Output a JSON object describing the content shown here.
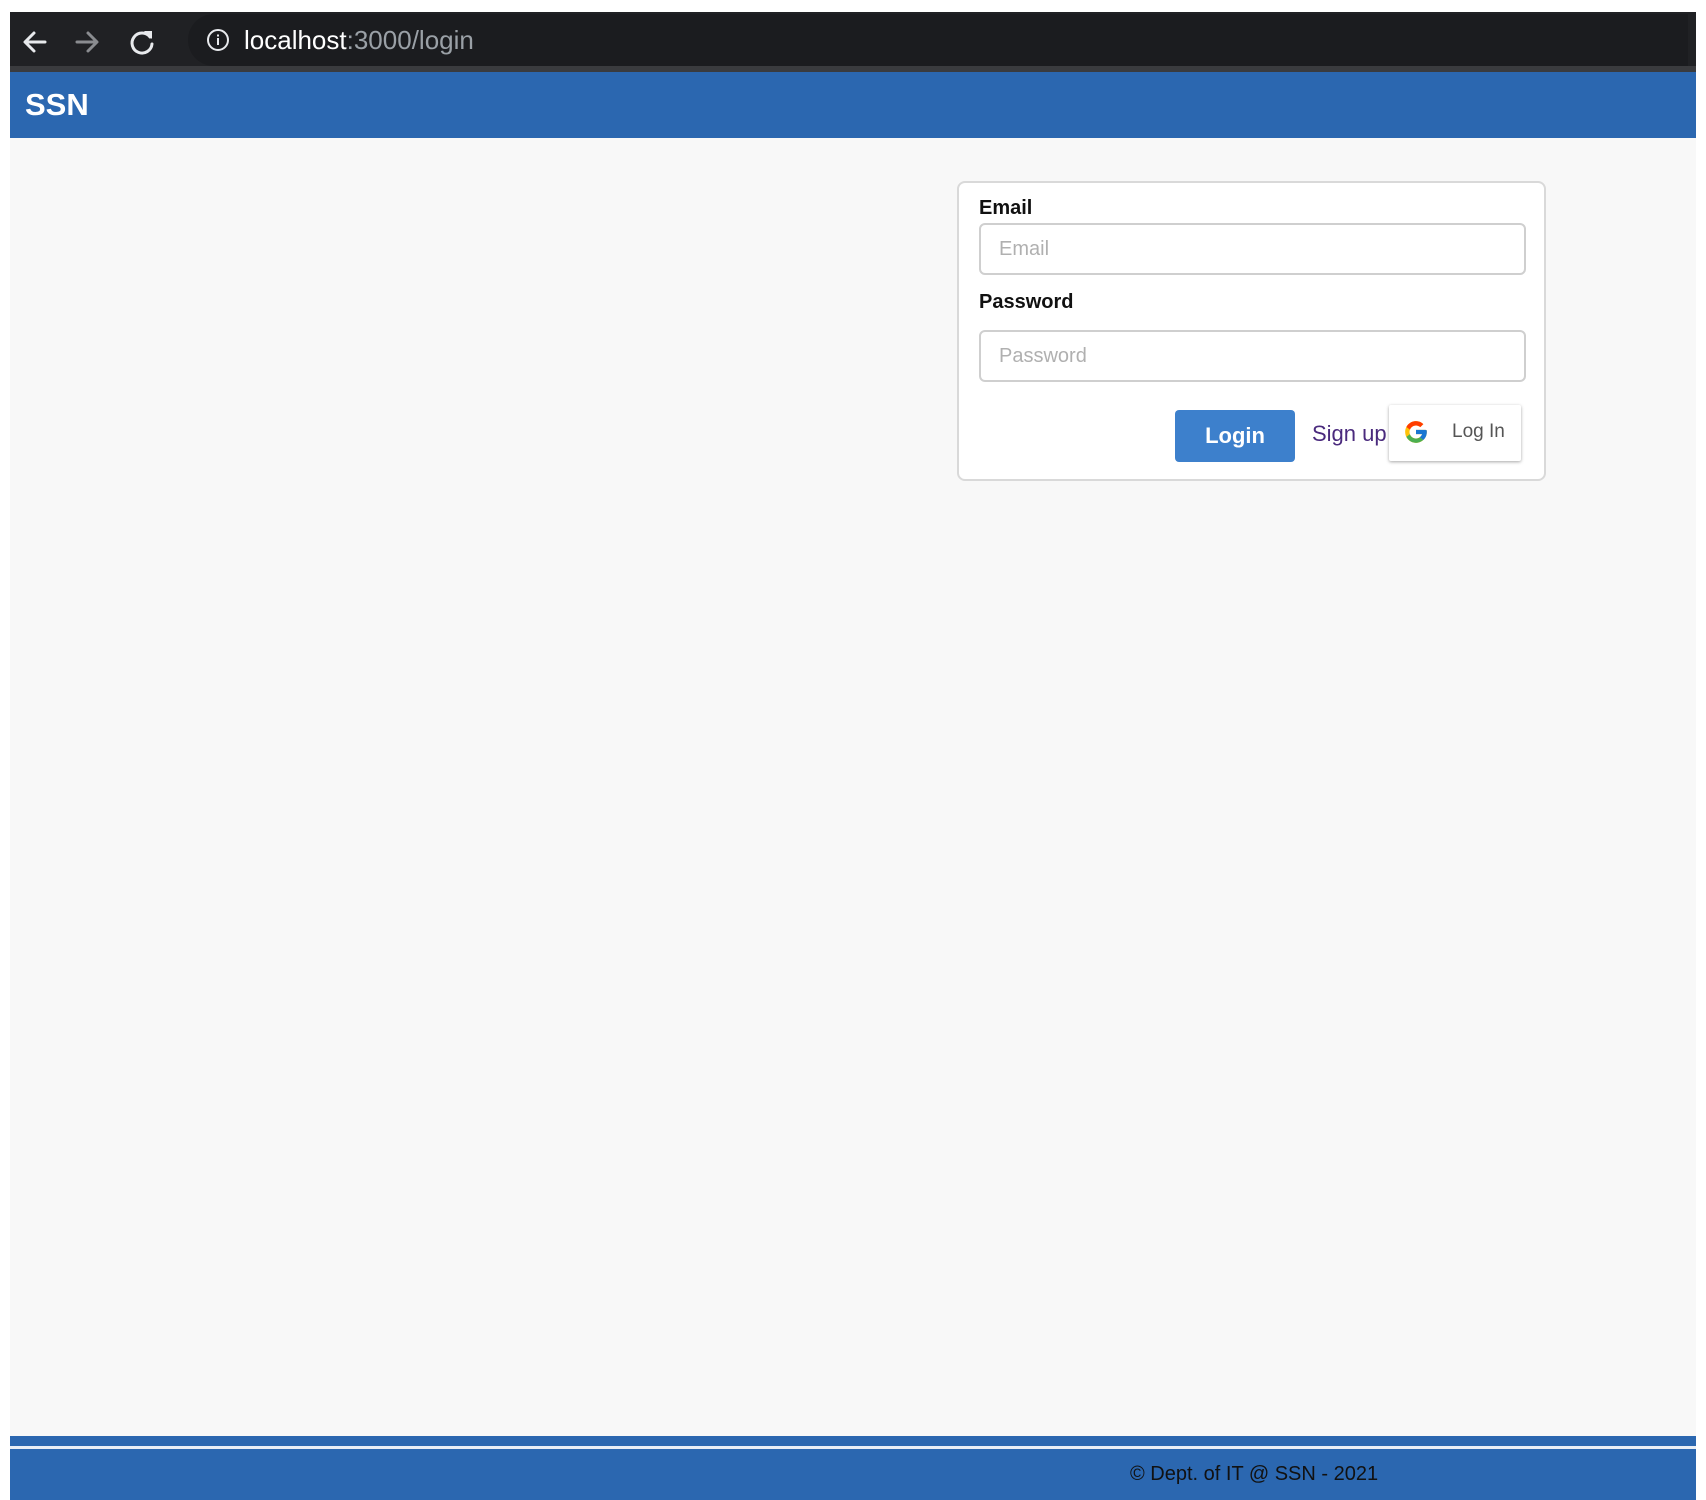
{
  "browser": {
    "url_host": "localhost",
    "url_rest": ":3000/login",
    "icons": {
      "back": "arrow-left-icon",
      "forward": "arrow-right-icon",
      "reload": "reload-icon",
      "site_info": "info-icon"
    }
  },
  "header": {
    "brand": "SSN",
    "color": "#2b67b0"
  },
  "login_form": {
    "email_label": "Email",
    "email_placeholder": "Email",
    "email_value": "",
    "password_label": "Password",
    "password_placeholder": "Password",
    "password_value": "",
    "login_button": "Login",
    "signup_link": "Sign up",
    "google_button": "Log In",
    "accent_color": "#3d80cc",
    "link_color": "#4a2a7d"
  },
  "footer": {
    "copyright": "© Dept. of IT @ SSN - 2021"
  }
}
